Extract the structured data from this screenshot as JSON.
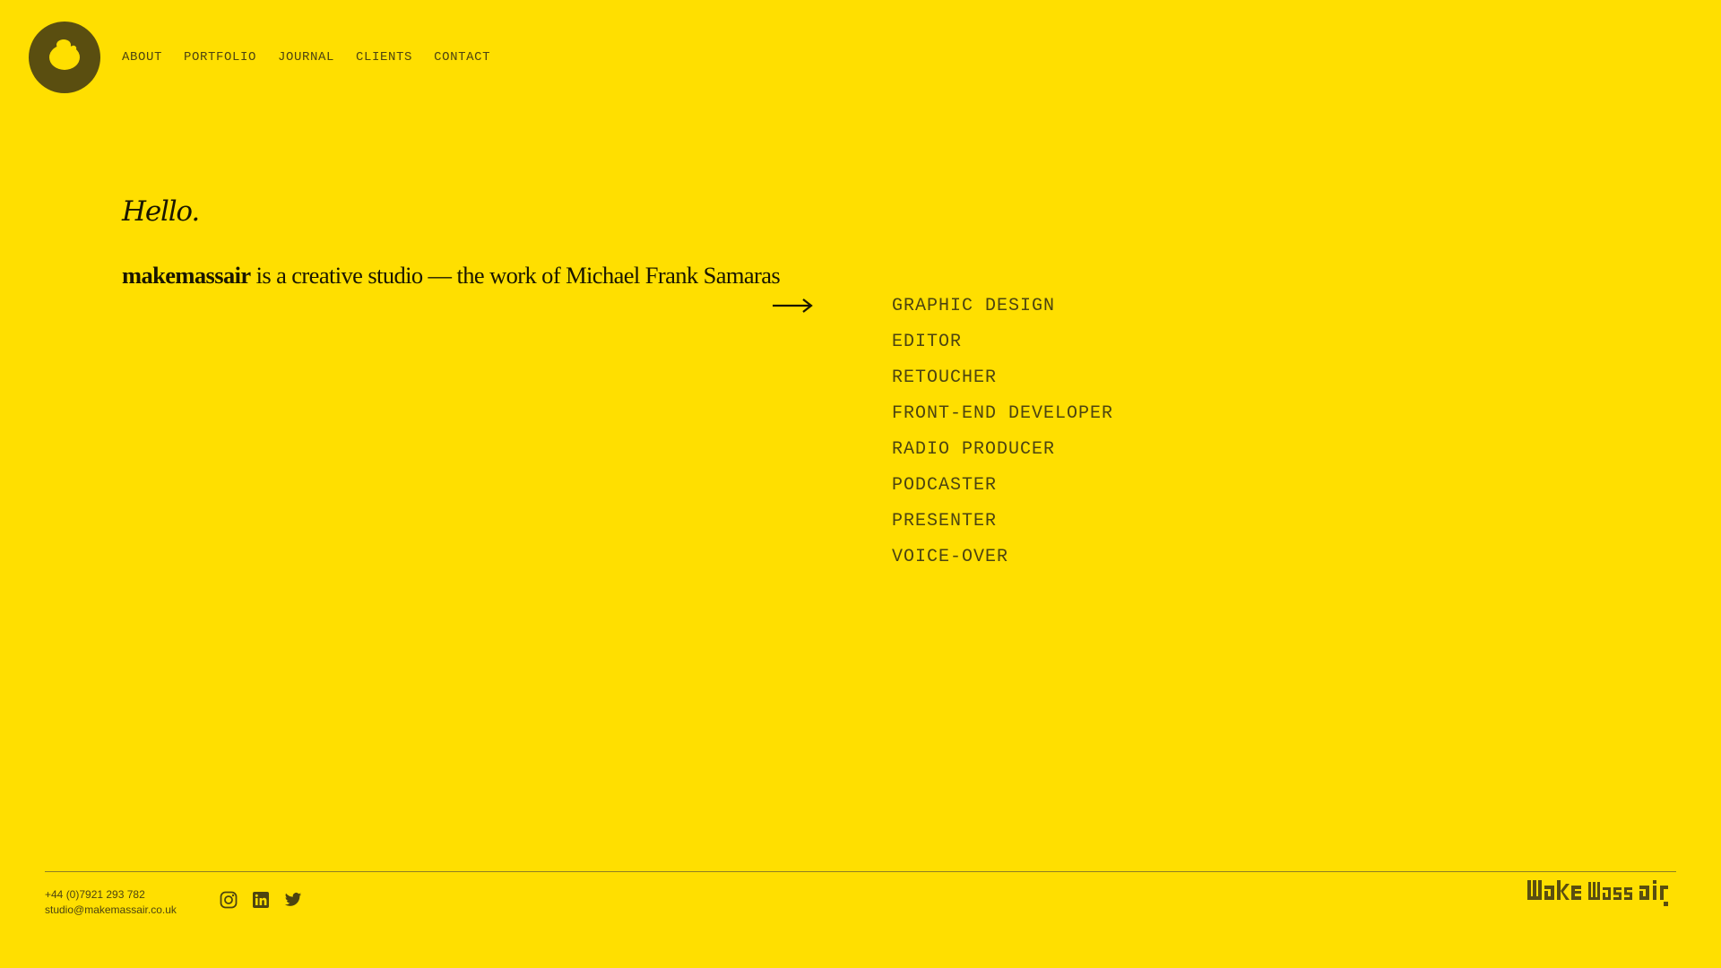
{
  "site": {
    "logo_icon": "face-blob-icon",
    "wordmark": "make mass air",
    "colors": {
      "background": "#FFDF00",
      "ink": "#4d4410",
      "heading": "#1a1600",
      "logo": "#5a4e10"
    }
  },
  "nav": {
    "items": [
      {
        "label": "ABOUT"
      },
      {
        "label": "PORTFOLIO"
      },
      {
        "label": "JOURNAL"
      },
      {
        "label": "CLIENTS"
      },
      {
        "label": "CONTACT"
      }
    ]
  },
  "hero": {
    "greeting": "Hello.",
    "brand": "makemassair",
    "tagline": " is a creative studio — the work of Michael Frank Samaras",
    "arrow_icon": "arrow-right-icon"
  },
  "roles": [
    "GRAPHIC DESIGN",
    "EDITOR",
    "RETOUCHER",
    "FRONT-END DEVELOPER",
    "RADIO PRODUCER",
    "PODCASTER",
    "PRESENTER",
    "VOICE-OVER"
  ],
  "footer": {
    "phone": "+44 (0)7921 293 782",
    "email": "studio@makemassair.co.uk",
    "social": [
      {
        "name": "instagram-icon"
      },
      {
        "name": "linkedin-icon"
      },
      {
        "name": "twitter-icon"
      }
    ]
  }
}
